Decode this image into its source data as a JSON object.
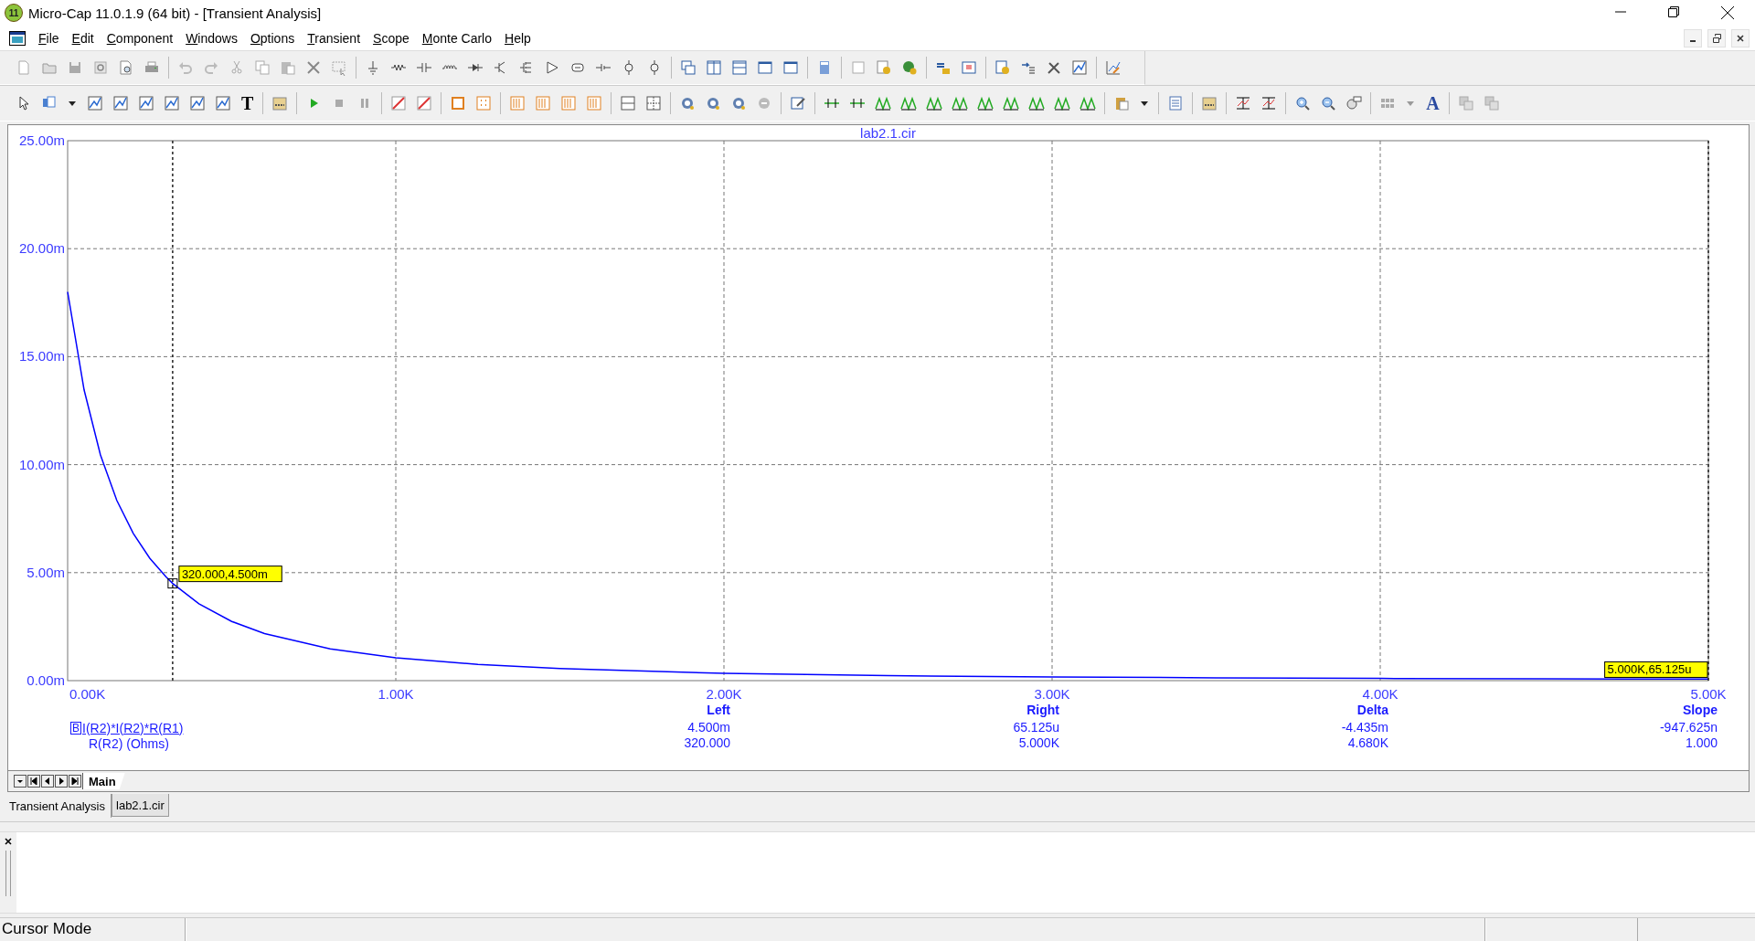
{
  "window": {
    "title": "Micro-Cap 11.0.1.9 (64 bit) - [Transient Analysis]",
    "logo_text": "11"
  },
  "menu": [
    "File",
    "Edit",
    "Component",
    "Windows",
    "Options",
    "Transient",
    "Scope",
    "Monte Carlo",
    "Help"
  ],
  "toolbar_glyphs": {
    "text_tool": "T",
    "font_tool": "A"
  },
  "plot": {
    "chart_data": {
      "type": "line",
      "title": "lab2.1.cir",
      "x": [
        0,
        50,
        100,
        150,
        200,
        250,
        300,
        320,
        400,
        500,
        600,
        800,
        1000,
        1250,
        1500,
        2000,
        2500,
        3000,
        3500,
        4000,
        4500,
        5000
      ],
      "series": [
        {
          "color": "#0000ff",
          "values": [
            18.0,
            13.46,
            10.45,
            8.34,
            6.82,
            5.67,
            4.8,
            4.5,
            3.56,
            2.74,
            2.18,
            1.47,
            1.06,
            0.75,
            0.56,
            0.34,
            0.23,
            0.17,
            0.13,
            0.1,
            0.08,
            0.07
          ]
        }
      ],
      "xlim": [
        0,
        5000
      ],
      "ylim": [
        0,
        25
      ],
      "xticks": [
        {
          "value": 0,
          "label": "0.00K"
        },
        {
          "value": 1000,
          "label": "1.00K"
        },
        {
          "value": 2000,
          "label": "2.00K"
        },
        {
          "value": 3000,
          "label": "3.00K"
        },
        {
          "value": 4000,
          "label": "4.00K"
        },
        {
          "value": 5000,
          "label": "5.00K"
        }
      ],
      "yticks": [
        {
          "value": 0,
          "label": "0.00m"
        },
        {
          "value": 5,
          "label": "5.00m"
        },
        {
          "value": 10,
          "label": "10.00m"
        },
        {
          "value": 15,
          "label": "15.00m"
        },
        {
          "value": 20,
          "label": "20.00m"
        },
        {
          "value": 25,
          "label": "25.00m"
        }
      ],
      "grid": true,
      "ref_lines": [
        {
          "axis": "x",
          "value": 320
        },
        {
          "axis": "x",
          "value": 5000
        }
      ],
      "annotations": [
        {
          "x": 320,
          "y": 4.5,
          "text": "320.000,4.500m"
        },
        {
          "x": 5000,
          "y": 0.065,
          "text": "5.000K,65.125u"
        }
      ]
    }
  },
  "readout": {
    "columns": [
      "Left",
      "Right",
      "Delta",
      "Slope"
    ],
    "rows": [
      {
        "marker": "B",
        "label": "I(R2)*I(R2)*R(R1)",
        "values": [
          "4.500m",
          "65.125u",
          "-4.435m",
          "-947.625n"
        ]
      },
      {
        "label": "R(R2) (Ohms)",
        "values": [
          "320.000",
          "5.000K",
          "4.680K",
          "1.000"
        ]
      }
    ]
  },
  "plot_tabs": [
    {
      "label": "Main",
      "selected": true
    }
  ],
  "document_tabs": [
    {
      "label": "Transient Analysis",
      "selected": true
    },
    {
      "label": "lab2.1.cir",
      "selected": false
    }
  ],
  "status_bar": {
    "text": "Cursor Mode"
  }
}
